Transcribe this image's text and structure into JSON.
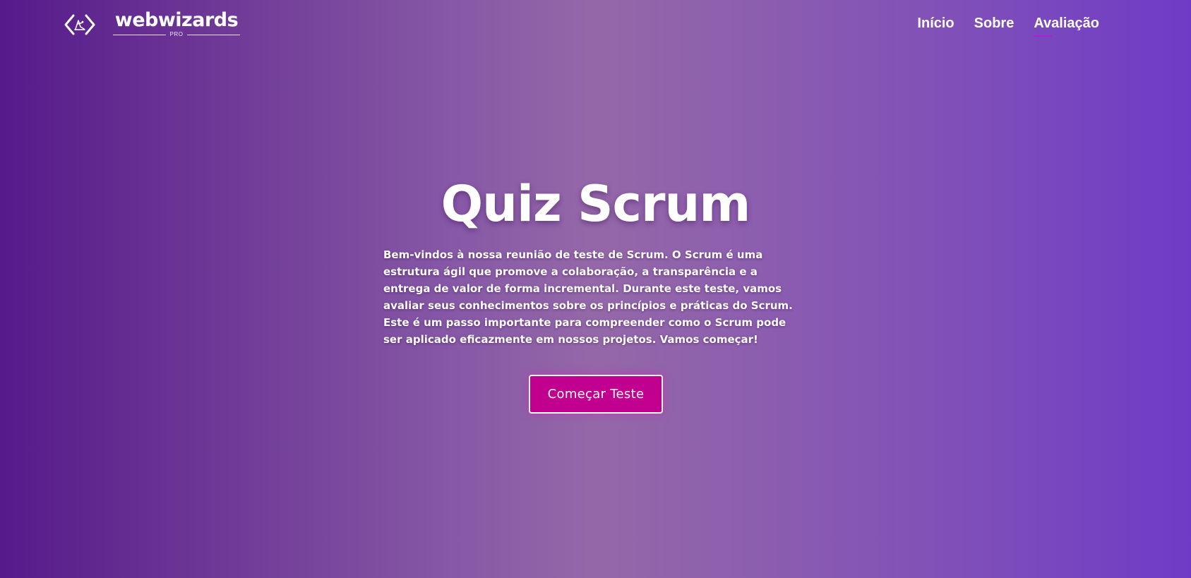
{
  "header": {
    "logo": {
      "wordmark": "webwizards",
      "tagline": "PRO",
      "icon": "code-brackets-wizard-icon"
    },
    "nav": [
      {
        "label": "Início",
        "active": false
      },
      {
        "label": "Sobre",
        "active": false
      },
      {
        "label": "Avaliação",
        "active": true
      }
    ]
  },
  "hero": {
    "title": "Quiz Scrum",
    "description": "Bem-vindos à nossa reunião de teste de Scrum. O Scrum é uma estrutura ágil que promove a colaboração, a transparência e a entrega de valor de forma incremental. Durante este teste, vamos avaliar seus conhecimentos sobre os princípios e práticas do Scrum. Este é um passo importante para compreender como o Scrum pode ser aplicado eficazmente em nossos projetos. Vamos começar!",
    "cta_label": "Começar Teste"
  },
  "colors": {
    "gradient_left": "#561a8a",
    "gradient_center": "#9468a8",
    "gradient_right": "#6f3bc6",
    "button_bg": "#c2008f",
    "nav_active_underline": "#b01fd2",
    "text": "#ffffff"
  }
}
